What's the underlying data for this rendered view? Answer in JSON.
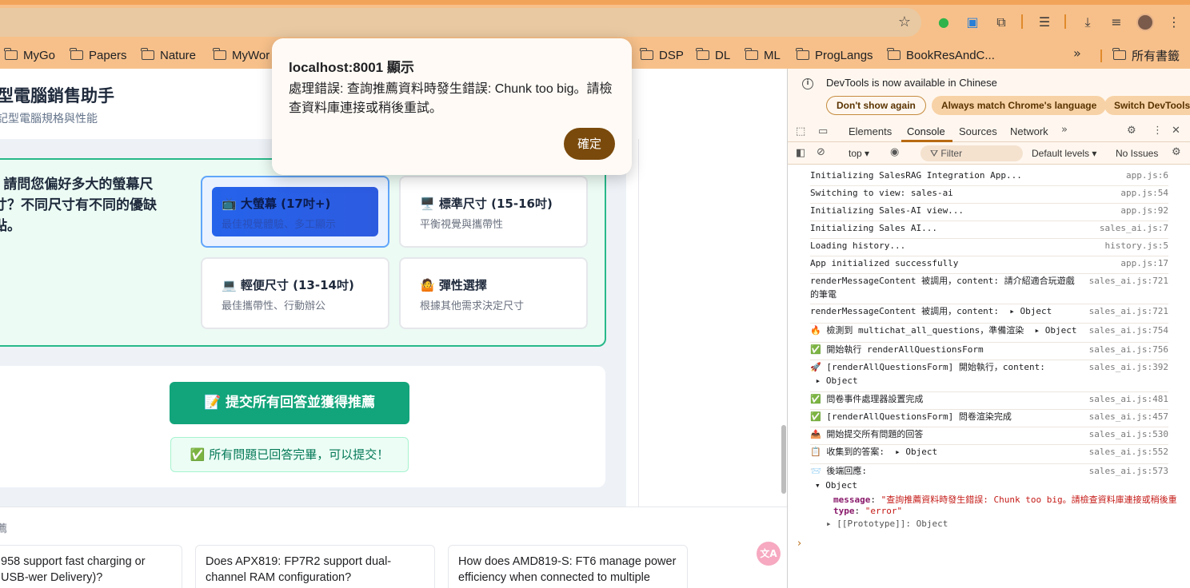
{
  "browser": {
    "bookmarks": [
      "MyGo",
      "Papers",
      "Nature",
      "MyWor",
      "DSP",
      "DL",
      "ML",
      "ProgLangs",
      "BookResAndC..."
    ],
    "all_bookmarks_label": "所有書籤",
    "more_glyph": "»"
  },
  "page": {
    "title": "型電腦銷售助手",
    "subtitle": "記型電腦規格與性能",
    "question": ". 請問您偏好多大的螢幕尺寸？不同尺寸有不同的優缺點。",
    "options": [
      {
        "icon": "📺",
        "title": "大螢幕 (17吋+)",
        "desc": "最佳視覺體驗、多工顯示",
        "selected": true
      },
      {
        "icon": "🖥️",
        "title": "標準尺寸 (15-16吋)",
        "desc": "平衡視覺與攜帶性",
        "selected": false
      },
      {
        "icon": "💻",
        "title": "輕便尺寸 (13-14吋)",
        "desc": "最佳攜帶性、行動辦公",
        "selected": false
      },
      {
        "icon": "🤷",
        "title": "彈性選擇",
        "desc": "根據其他需求決定尺寸",
        "selected": false
      }
    ],
    "submit_label": "📝 提交所有回答並獲得推薦",
    "complete_msg": "✅ 所有問題已回答完畢，可以提交！",
    "suggest_label": "薦",
    "suggestions": [
      "958 support fast charging or USB-wer Delivery)?",
      "Does APX819: FP7R2 support dual-channel RAM configuration?",
      "How does AMD819-S: FT6 manage power efficiency when connected to multiple displays?"
    ]
  },
  "dialog": {
    "title": "localhost:8001 顯示",
    "message": "處理錯誤: 查詢推薦資料時發生錯誤: Chunk too big。請檢查資料庫連接或稍後重試。",
    "ok_label": "確定"
  },
  "devtools": {
    "notice": "DevTools is now available in Chinese",
    "btn_dont_show": "Don't show again",
    "btn_always_match": "Always match Chrome's language",
    "btn_switch": "Switch DevTools t",
    "tabs": [
      "Elements",
      "Console",
      "Sources",
      "Network"
    ],
    "active_tab": "Console",
    "context": "top ▾",
    "filter_placeholder": "Filter",
    "levels": "Default levels ▾",
    "issues": "No Issues",
    "logs": [
      {
        "msg": "Initializing SalesRAG Integration App...",
        "src": "app.js:6"
      },
      {
        "msg": "Switching to view: sales-ai",
        "src": "app.js:54"
      },
      {
        "msg": "Initializing Sales-AI view...",
        "src": "app.js:92"
      },
      {
        "msg": "Initializing Sales AI...",
        "src": "sales_ai.js:7"
      },
      {
        "msg": "Loading history...",
        "src": "history.js:5"
      },
      {
        "msg": "App initialized successfully",
        "src": "app.js:17"
      },
      {
        "msg": "renderMessageContent 被調用，content: 請介紹適合玩遊戲的筆電",
        "src": "sales_ai.js:721"
      },
      {
        "msg": "renderMessageContent 被調用，content:  ▸ Object",
        "src": "sales_ai.js:721"
      },
      {
        "msg": "🔥 檢測到 multichat_all_questions，準備渲染  ▸ Object",
        "src": "sales_ai.js:754"
      },
      {
        "msg": "✅ 開始執行 renderAllQuestionsForm",
        "src": "sales_ai.js:756"
      },
      {
        "msg": "🚀 [renderAllQuestionsForm] 開始執行，content:\n ▸ Object",
        "src": "sales_ai.js:392"
      },
      {
        "msg": "✅ 問卷事件處理器設置完成",
        "src": "sales_ai.js:481"
      },
      {
        "msg": "✅ [renderAllQuestionsForm] 問卷渲染完成",
        "src": "sales_ai.js:457"
      },
      {
        "msg": "📤 開始提交所有問題的回答",
        "src": "sales_ai.js:530"
      },
      {
        "msg": "📋 收集到的答案:  ▸ Object",
        "src": "sales_ai.js:552"
      },
      {
        "msg": "📨 後端回應:",
        "src": "sales_ai.js:573"
      }
    ],
    "object_label": "▾ Object",
    "prop_message_key": "message",
    "prop_message_val": "\"查詢推薦資料時發生錯誤: Chunk too big。請檢查資料庫連接或稍後重",
    "prop_type_key": "type",
    "prop_type_val": "\"error\"",
    "prop_proto": "▸ [[Prototype]]: Object",
    "prompt": "›"
  }
}
